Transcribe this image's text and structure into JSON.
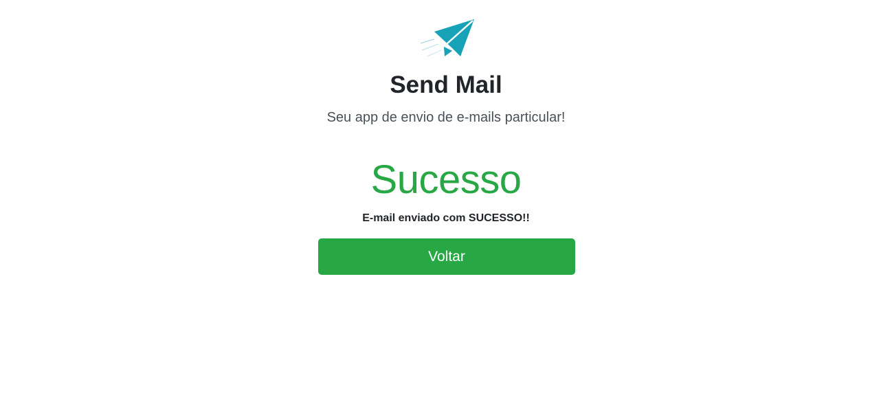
{
  "header": {
    "logo_icon": "paper-plane-icon",
    "logo_color": "#17a2b8",
    "title": "Send Mail",
    "subtitle": "Seu app de envio de e-mails particular!"
  },
  "result": {
    "heading": "Sucesso",
    "heading_color": "#28a745",
    "message": "E-mail enviado com SUCESSO!!"
  },
  "actions": {
    "back_label": "Voltar",
    "back_color": "#28a745"
  }
}
